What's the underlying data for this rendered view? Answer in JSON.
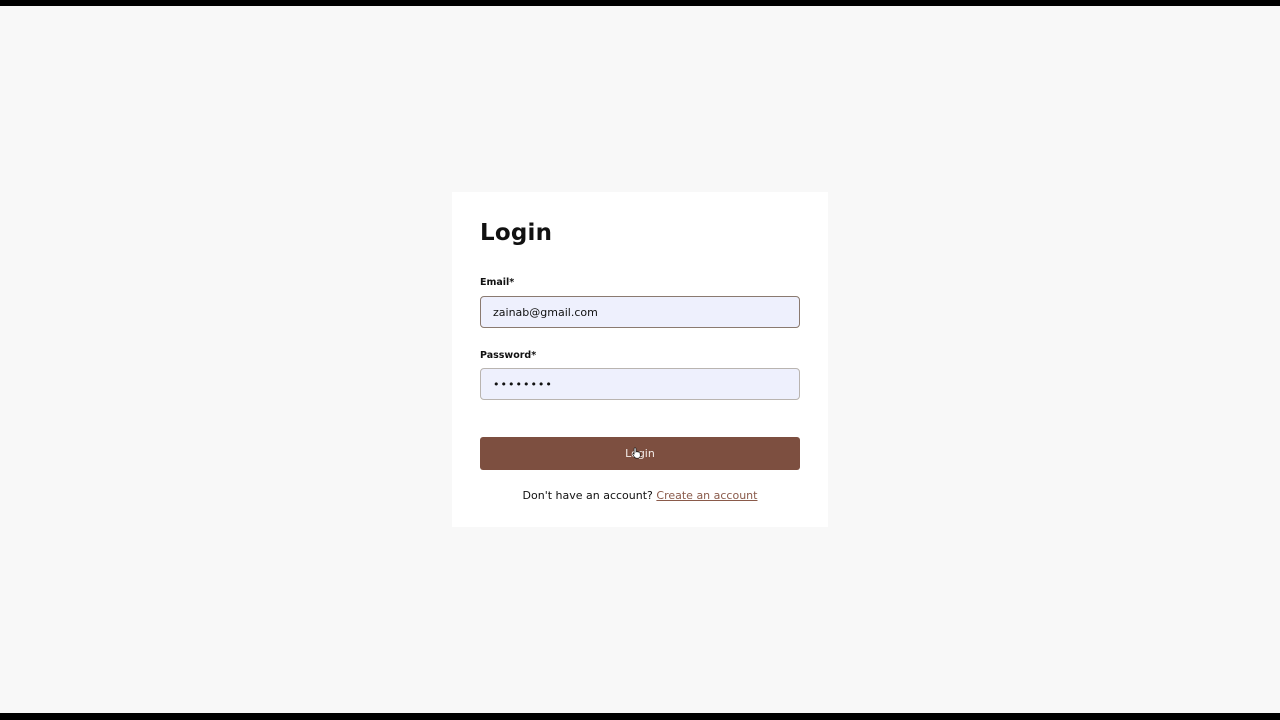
{
  "login_form": {
    "title": "Login",
    "email_label": "Email*",
    "email_value": "zainab@gmail.com",
    "password_label": "Password*",
    "password_value": "••••••••",
    "login_button_label": "Login",
    "signup_prompt": "Don't have an account?",
    "signup_link_label": "Create an account"
  },
  "colors": {
    "accent_button": "#7d4f40",
    "link": "#8a5a4a",
    "input_background": "#eef0fd",
    "page_background": "#f8f8f8"
  },
  "icons": {
    "cursor": "hand-pointer-icon"
  }
}
